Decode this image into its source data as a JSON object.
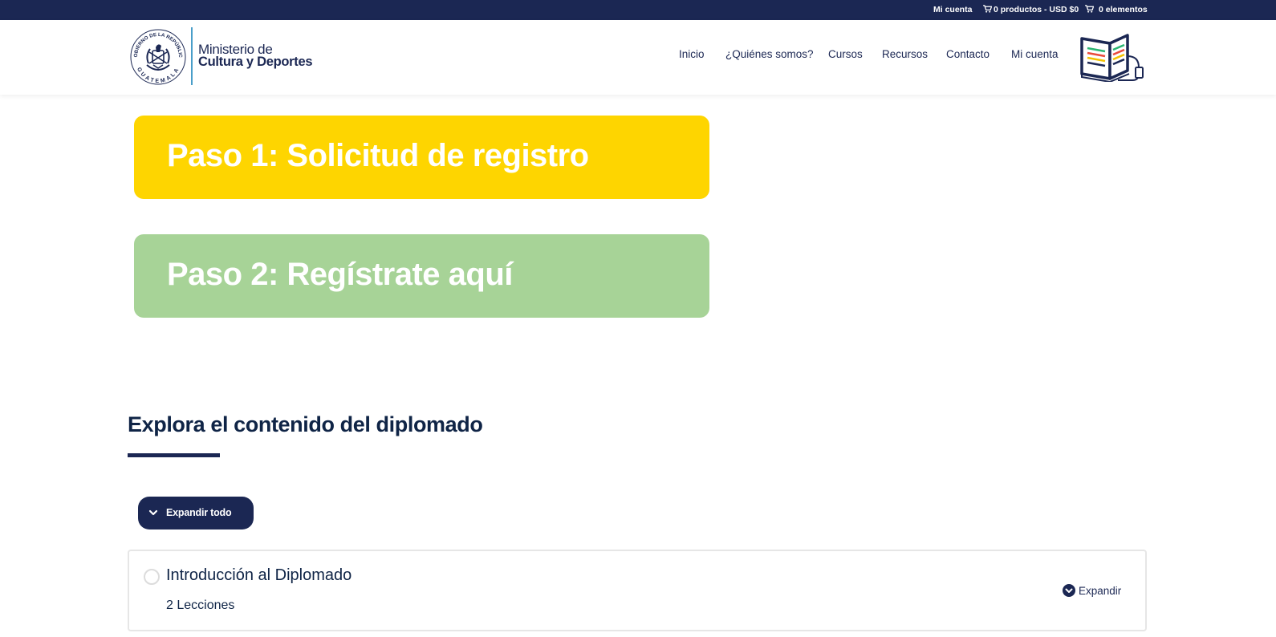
{
  "topbar": {
    "account": "Mi cuenta",
    "cart_products": "0 productos - USD $0",
    "cart_items": "0 elementos",
    "cart_icon": "cart-icon"
  },
  "logo": {
    "seal_icon": "guatemala-seal-logo",
    "seal_text_top": "GOBIERNO DE LA REPÚBLICA",
    "seal_text_bottom": "GUATEMALA",
    "line1": "Ministerio de",
    "line2": "Cultura y Deportes"
  },
  "nav": {
    "items": [
      "Inicio",
      "¿Quiénes somos?",
      "Cursos",
      "Recursos",
      "Contacto",
      "Mi cuenta"
    ],
    "site_icon": "digital-book-icon"
  },
  "steps": {
    "step1": "Paso 1: Solicitud de registro",
    "step2": "Paso 2: Regístrate aquí"
  },
  "colors": {
    "navy": "#1b2753",
    "yellow": "#fed500",
    "green": "#a7d397"
  },
  "content": {
    "section_heading": "Explora el contenido del diplomado",
    "expand_all_label": "Expandir todo",
    "sections": [
      {
        "title": "Introducción al Diplomado",
        "lessons": "2 Lecciones",
        "expand_label": "Expandir"
      }
    ]
  }
}
